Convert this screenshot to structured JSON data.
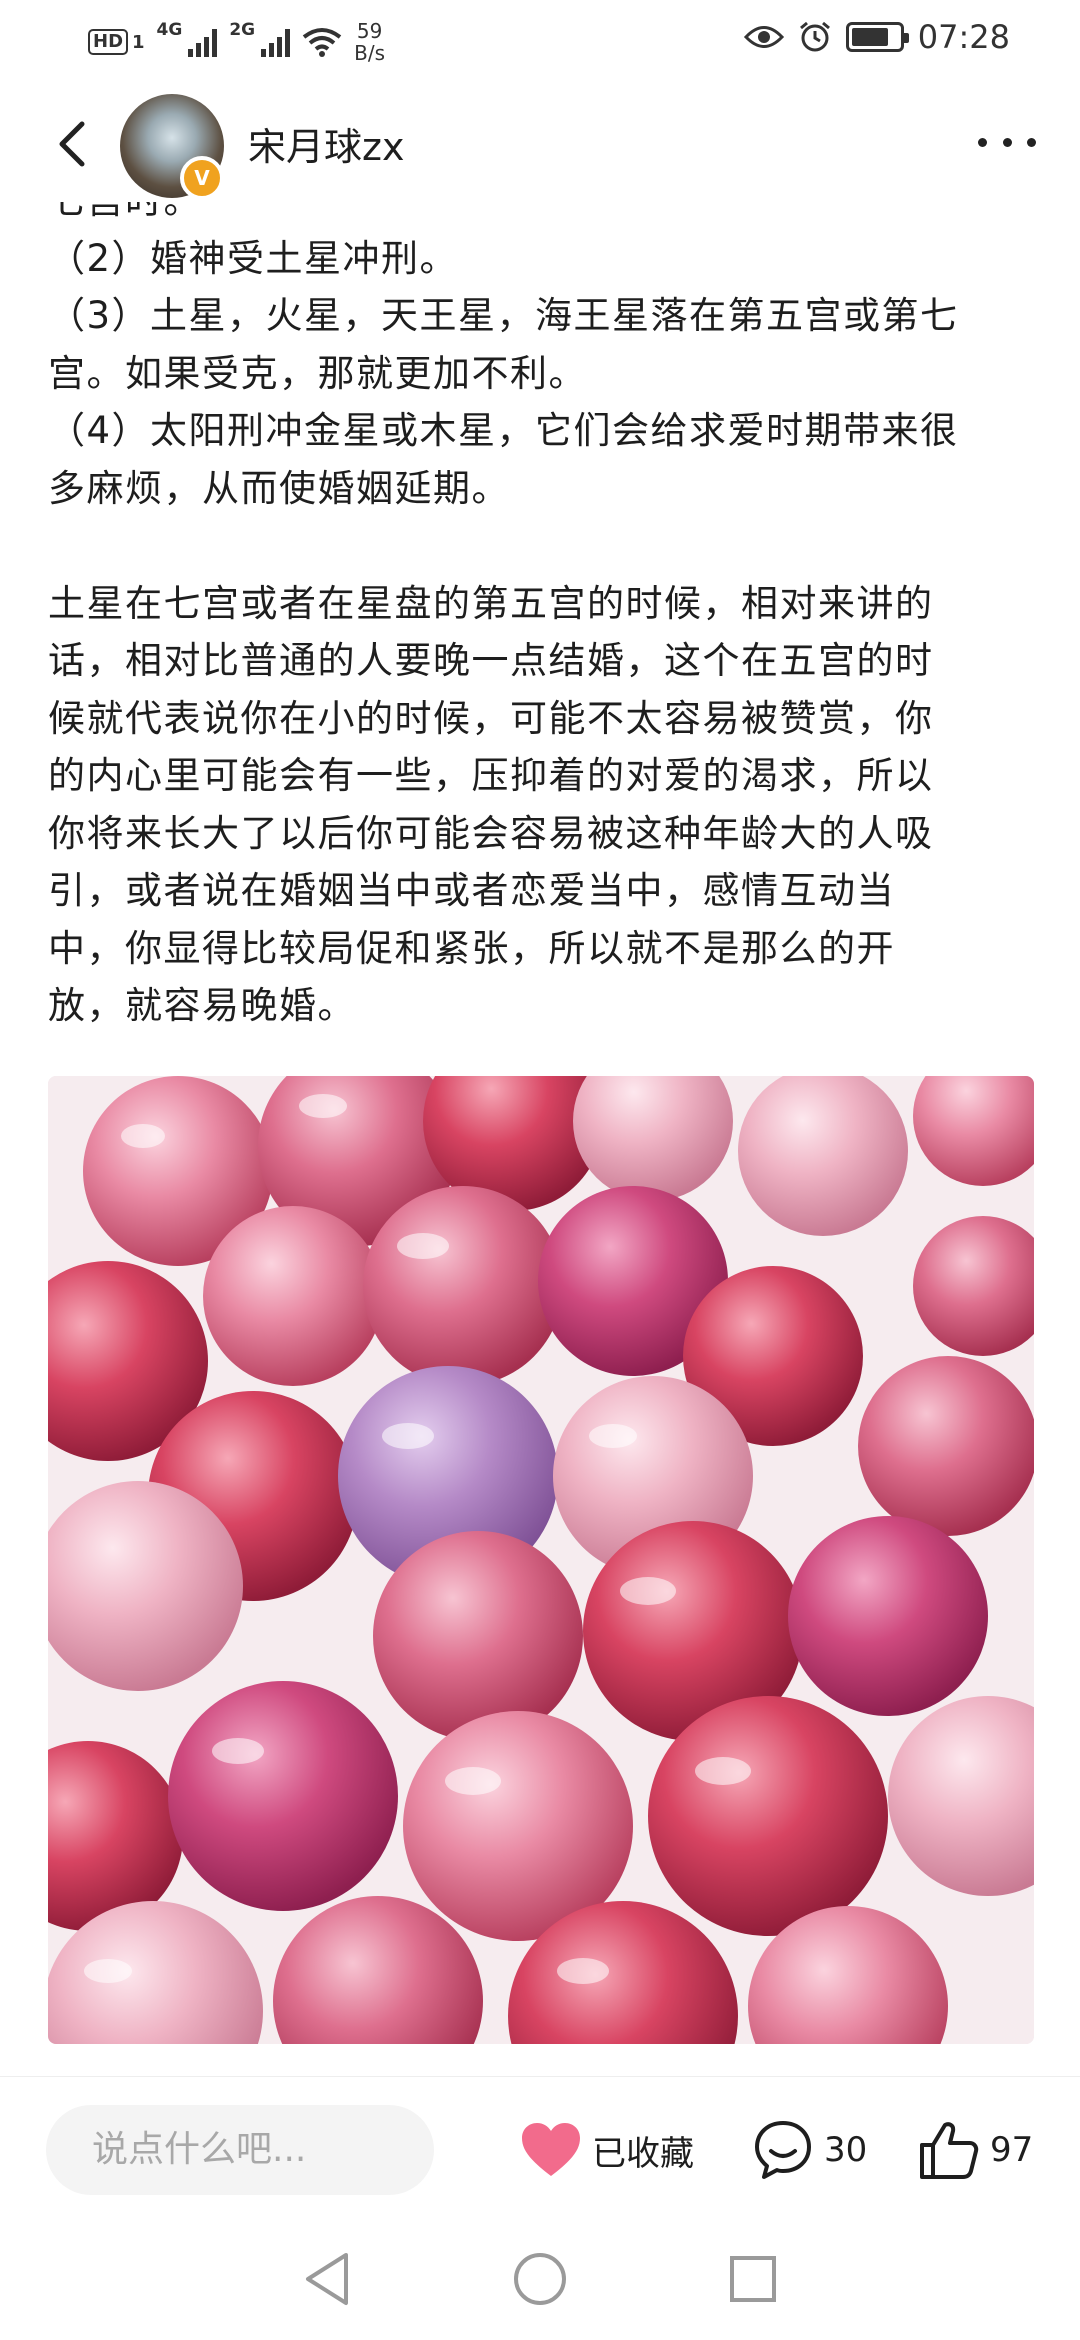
{
  "status_bar": {
    "hd": "HD",
    "sim1": "1",
    "net1": "4G",
    "net2": "2G",
    "speed_value": "59",
    "speed_unit": "B/s",
    "time": "07:28",
    "icons": [
      "eye-icon",
      "alarm-icon",
      "battery-icon"
    ]
  },
  "header": {
    "author_name": "宋月球zx",
    "badge": "V",
    "icons": [
      "back-arrow-icon",
      "more-icon"
    ]
  },
  "article": {
    "clipped_line": "七宫时。",
    "lines_block1": [
      "（2）婚神受土星冲刑。",
      "（3）土星，火星，天王星，海王星落在第五宫或第七",
      "宫。如果受克，那就更加不利。",
      "（4）太阳刑冲金星或木星，它们会给求爱时期带来很",
      "多麻烦，从而使婚姻延期。"
    ],
    "lines_block2": [
      "土星在七宫或者在星盘的第五宫的时候，相对来讲的",
      "话，相对比普通的人要晚一点结婚，这个在五宫的时",
      "候就代表说你在小的时候，可能不太容易被赞赏，你",
      "的内心里可能会有一些，压抑着的对爱的渴求，所以",
      "你将来长大了以后你可能会容易被这种年龄大的人吸",
      "引，或者说在婚姻当中或者恋爱当中，感情互动当",
      "中，你显得比较局促和紧张，所以就不是那么的开",
      "放，就容易晚婚。"
    ]
  },
  "bottom_bar": {
    "comment_placeholder": "说点什么吧...",
    "favorite_label": "已收藏",
    "comment_count": "30",
    "like_count": "97",
    "favorite_color": "#f26b8c"
  },
  "nav": {
    "icons": [
      "nav-back-icon",
      "nav-home-icon",
      "nav-recents-icon"
    ]
  }
}
